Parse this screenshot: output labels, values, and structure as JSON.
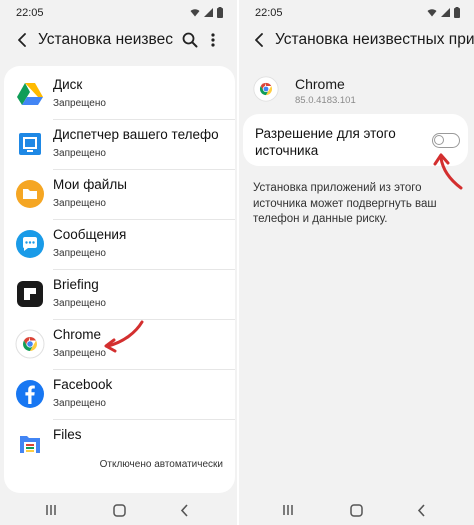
{
  "left": {
    "status_time": "22:05",
    "title": "Установка неизвес",
    "apps": [
      {
        "name": "Диск",
        "status": "Запрещено",
        "icon": "google-drive-icon"
      },
      {
        "name": "Диспетчер вашего телефо",
        "status": "Запрещено",
        "icon": "device-manager-icon"
      },
      {
        "name": "Мои файлы",
        "status": "Запрещено",
        "icon": "folder-icon"
      },
      {
        "name": "Сообщения",
        "status": "Запрещено",
        "icon": "messages-icon"
      },
      {
        "name": "Briefing",
        "status": "Запрещено",
        "icon": "briefing-icon"
      },
      {
        "name": "Chrome",
        "status": "Запрещено",
        "icon": "chrome-icon"
      },
      {
        "name": "Facebook",
        "status": "Запрещено",
        "icon": "facebook-icon"
      },
      {
        "name": "Files",
        "status": "Отключено автоматически",
        "icon": "files-icon"
      }
    ]
  },
  "right": {
    "status_time": "22:05",
    "title": "Установка неизвестных прил",
    "app": {
      "name": "Chrome",
      "version": "85.0.4183.101",
      "icon": "chrome-icon"
    },
    "permission": {
      "label": "Разрешение для этого источника",
      "enabled": false
    },
    "warning": "Установка приложений из этого источника может подвергнуть ваш телефон и данные риску."
  },
  "colors": {
    "background": "#f2f2f2",
    "card": "#ffffff",
    "annotation_arrow": "#d32f2f"
  }
}
